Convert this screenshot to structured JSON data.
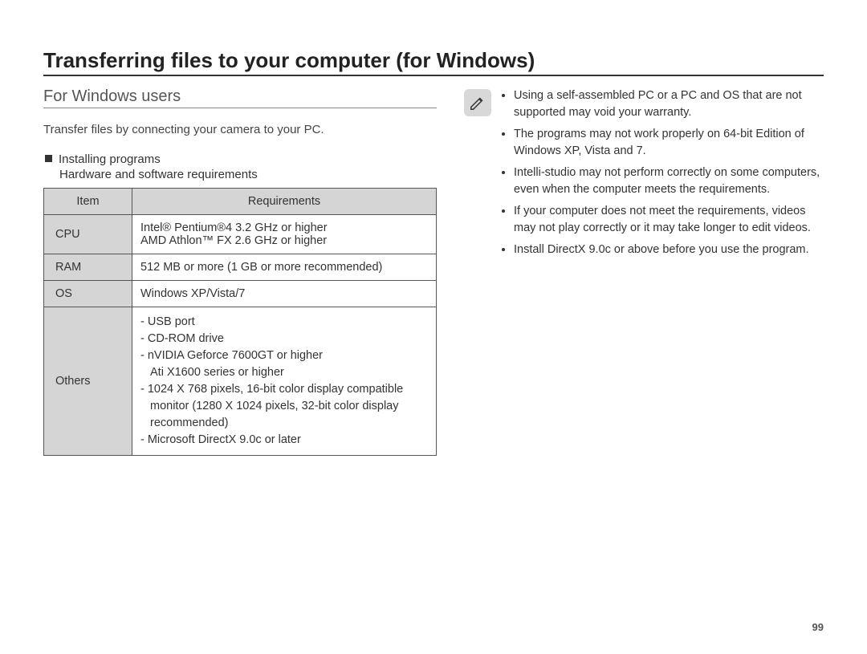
{
  "pageNumber": "99",
  "title": "Transferring files to your computer (for Windows)",
  "subtitle": "For Windows users",
  "introText": "Transfer files by connecting your camera to your PC.",
  "installHeader": "Installing programs",
  "reqHeader": "Hardware and software requirements",
  "table": {
    "headers": {
      "item": "Item",
      "req": "Requirements"
    },
    "rows": {
      "cpu": {
        "item": "CPU",
        "line1": "Intel® Pentium®4 3.2 GHz or higher",
        "line2": "AMD Athlon™ FX 2.6 GHz or higher"
      },
      "ram": {
        "item": "RAM",
        "value": "512 MB or more (1 GB or more recommended)"
      },
      "os": {
        "item": "OS",
        "value": "Windows XP/Vista/7"
      },
      "others": {
        "item": "Others",
        "l1": "- USB port",
        "l2": "- CD-ROM drive",
        "l3": "- nVIDIA Geforce 7600GT or higher",
        "l3b": "Ati X1600 series or higher",
        "l4": "- 1024 X 768 pixels, 16-bit color display compatible",
        "l4b": "monitor (1280 X 1024 pixels, 32-bit color display",
        "l4c": "recommended)",
        "l5": "- Microsoft DirectX 9.0c or later"
      }
    }
  },
  "notes": {
    "n1": "Using a self-assembled  PC or a PC and OS that are not supported may void your warranty.",
    "n2": "The programs may not work properly on 64-bit Edition of Windows XP, Vista and 7.",
    "n3": "Intelli-studio may not perform correctly on some computers, even when the computer meets the requirements.",
    "n4": "If your computer does not meet the requirements, videos may not play correctly or it may take longer to edit videos.",
    "n5": "Install DirectX 9.0c or above before you use the program."
  }
}
